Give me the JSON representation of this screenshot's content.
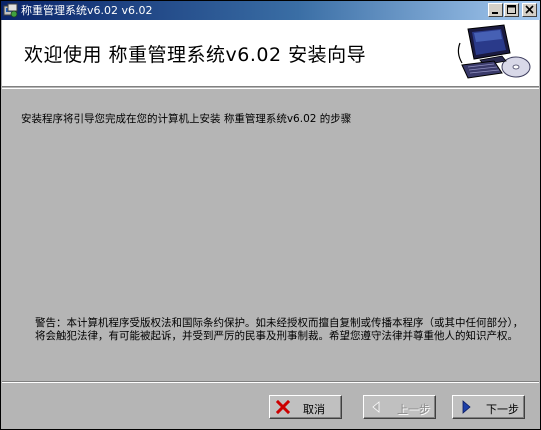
{
  "window": {
    "title": "称重管理系统v6.02 v6.02"
  },
  "header": {
    "title": "欢迎使用 称重管理系统v6.02 安装向导"
  },
  "main": {
    "intro": "安装程序将引导您完成在您的计算机上安装 称重管理系统v6.02 的步骤",
    "warning": "警告：本计算机程序受版权法和国际条约保护。如未经授权而擅自复制或传播本程序（或其中任何部分），将会触犯法律，有可能被起诉，并受到严厉的民事及刑事制裁。希望您遵守法律并尊重他人的知识产权。"
  },
  "buttons": {
    "cancel": "取消",
    "prev": "上一步",
    "next": "下一步"
  },
  "colors": {
    "titlebar_start": "#0a246a",
    "titlebar_end": "#a6caf0",
    "body_bg": "#b5b5b5",
    "cancel_icon": "#cc0000",
    "next_icon": "#1c3fa8"
  },
  "icons": {
    "app": "installer-app-icon",
    "header_art": "computer-with-cd-icon",
    "cancel": "red-x-icon",
    "prev": "left-arrow-icon",
    "next": "right-arrow-icon"
  }
}
